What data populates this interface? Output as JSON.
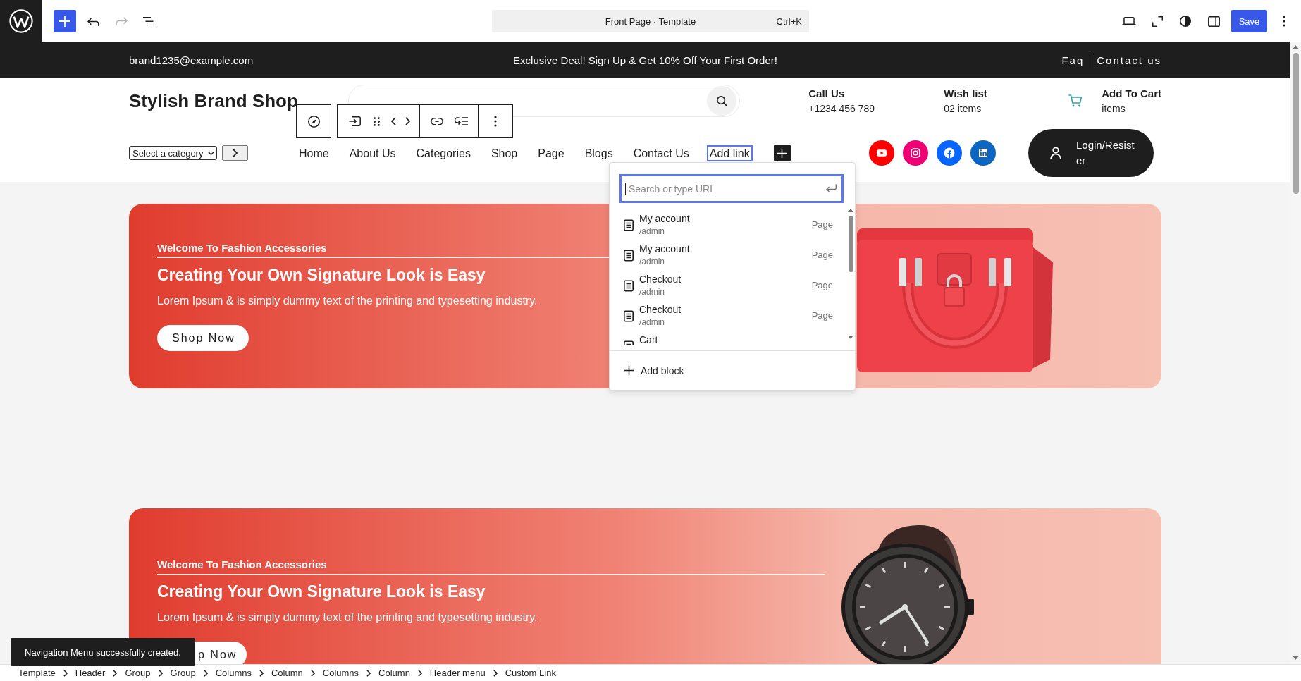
{
  "editor_toolbar": {
    "document_title": "Front Page · Template",
    "shortcut": "Ctrl+K",
    "save_label": "Save"
  },
  "announcement_bar": {
    "email": "brand1235@example.com",
    "offer": "Exclusive Deal! Sign Up & Get 10% Off Your First Order!",
    "links": [
      "Faq",
      "Contact us"
    ]
  },
  "header": {
    "brand": "Stylish Brand Shop",
    "info": [
      {
        "kind": "text",
        "label": "Call Us",
        "value": "+1234 456 789"
      },
      {
        "kind": "text",
        "label": "Wish list",
        "value": "02 items"
      },
      {
        "kind": "cart",
        "label": "Add To Cart",
        "value": "items"
      }
    ],
    "category_select": {
      "value": "Select a category"
    },
    "nav": {
      "items": [
        {
          "label": "Home",
          "selected": false
        },
        {
          "label": "About Us",
          "selected": false
        },
        {
          "label": "Categories",
          "selected": false
        },
        {
          "label": "Shop",
          "selected": false
        },
        {
          "label": "Page",
          "selected": false
        },
        {
          "label": "Blogs",
          "selected": false
        },
        {
          "label": "Contact Us",
          "selected": false
        },
        {
          "label": "Add link",
          "selected": true
        }
      ]
    },
    "social_links": [
      {
        "kind": "youtube",
        "color": "#ff0000"
      },
      {
        "kind": "instagram",
        "color": "#f00075"
      },
      {
        "kind": "facebook",
        "color": "#0866ff"
      },
      {
        "kind": "linkedin",
        "color": "#0d66c2"
      }
    ],
    "login_button": "Login/Resister"
  },
  "link_popover": {
    "search": {
      "placeholder": "Search or type URL"
    },
    "results": [
      {
        "title": "My account",
        "path": "/admin",
        "type": "Page"
      },
      {
        "title": "My account",
        "path": "/admin",
        "type": "Page"
      },
      {
        "title": "Checkout",
        "path": "/admin",
        "type": "Page"
      },
      {
        "title": "Checkout",
        "path": "/admin",
        "type": "Page"
      },
      {
        "title": "Cart"
      }
    ],
    "add_block": "Add block"
  },
  "banners": [
    {
      "kind": "handbag",
      "eyebrow": "Welcome To Fashion Accessories",
      "heading": "Creating Your Own Signature Look is Easy",
      "text": "Lorem Ipsum & is simply dummy text of the printing and typesetting industry.",
      "button": "Shop Now",
      "button_covered": false
    },
    {
      "kind": "watch",
      "eyebrow": "Welcome To Fashion Accessories",
      "heading": "Creating Your Own Signature Look is Easy",
      "text": "Lorem Ipsum & is simply dummy text of the printing and typesetting industry.",
      "button": "p Now",
      "button_covered": true
    }
  ],
  "snackbar": {
    "message": "Navigation Menu successfully created."
  },
  "breadcrumbs": [
    "Template",
    "Header",
    "Group",
    "Group",
    "Columns",
    "Column",
    "Columns",
    "Column",
    "Header menu",
    "Custom Link"
  ]
}
